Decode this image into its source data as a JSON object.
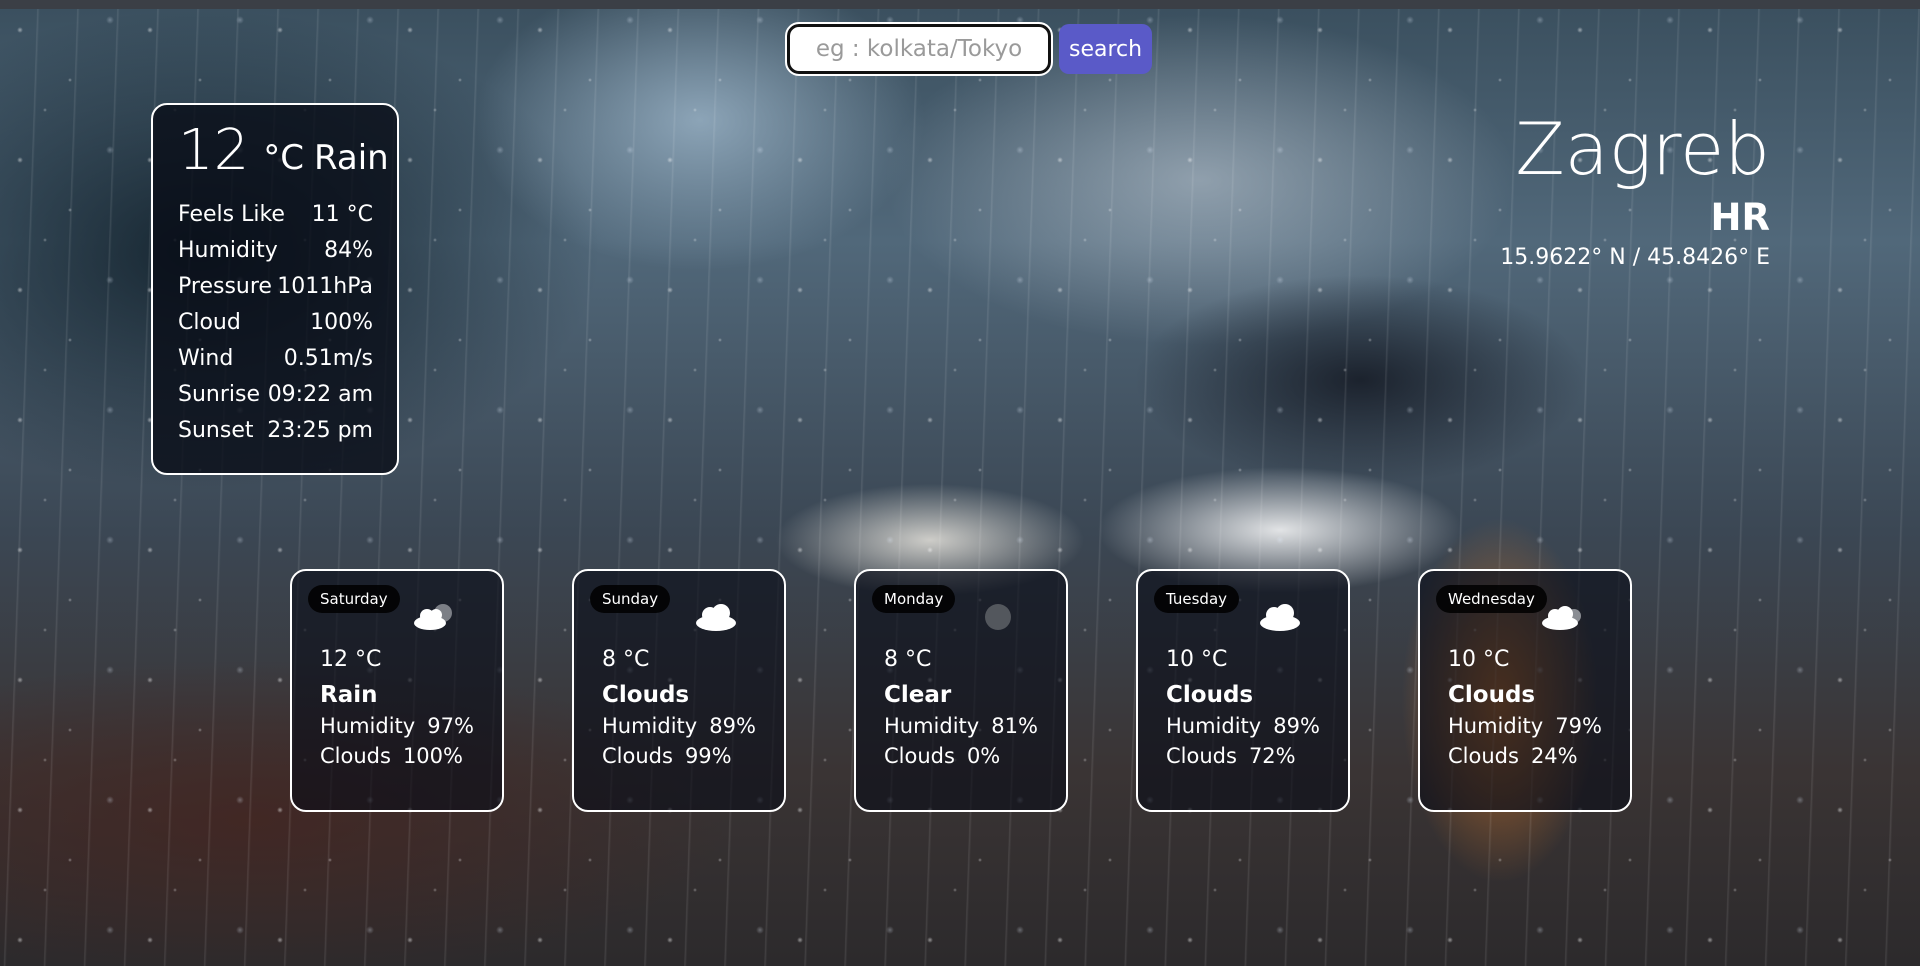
{
  "search": {
    "placeholder": "eg : kolkata/Tokyo",
    "button_label": "search"
  },
  "current": {
    "temp": "12",
    "unit": "°C",
    "condition": "Rain",
    "stats": [
      {
        "label": "Feels Like",
        "value": "11 °C"
      },
      {
        "label": "Humidity",
        "value": "84%"
      },
      {
        "label": "Pressure",
        "value": "1011hPa"
      },
      {
        "label": "Cloud",
        "value": "100%"
      },
      {
        "label": "Wind",
        "value": "0.51m/s"
      },
      {
        "label": "Sunrise",
        "value": "09:22 am"
      },
      {
        "label": "Sunset",
        "value": "23:25 pm"
      }
    ]
  },
  "location": {
    "city": "Zagreb",
    "country": "HR",
    "coords": "15.9622° N / 45.8426° E"
  },
  "forecast": [
    {
      "day": "Saturday",
      "icon": "cloud-rain-icon",
      "temp": "12 °C",
      "condition": "Rain",
      "humidity_label": "Humidity",
      "humidity": "97%",
      "clouds_label": "Clouds",
      "clouds": "100%"
    },
    {
      "day": "Sunday",
      "icon": "cloud-icon",
      "temp": "8 °C",
      "condition": "Clouds",
      "humidity_label": "Humidity",
      "humidity": "89%",
      "clouds_label": "Clouds",
      "clouds": "99%"
    },
    {
      "day": "Monday",
      "icon": "clear-moon-icon",
      "temp": "8 °C",
      "condition": "Clear",
      "humidity_label": "Humidity",
      "humidity": "81%",
      "clouds_label": "Clouds",
      "clouds": "0%"
    },
    {
      "day": "Tuesday",
      "icon": "cloud-icon",
      "temp": "10 °C",
      "condition": "Clouds",
      "humidity_label": "Humidity",
      "humidity": "89%",
      "clouds_label": "Clouds",
      "clouds": "72%"
    },
    {
      "day": "Wednesday",
      "icon": "cloud-icon",
      "temp": "10 °C",
      "condition": "Clouds",
      "humidity_label": "Humidity",
      "humidity": "79%",
      "clouds_label": "Clouds",
      "clouds": "24%"
    }
  ]
}
